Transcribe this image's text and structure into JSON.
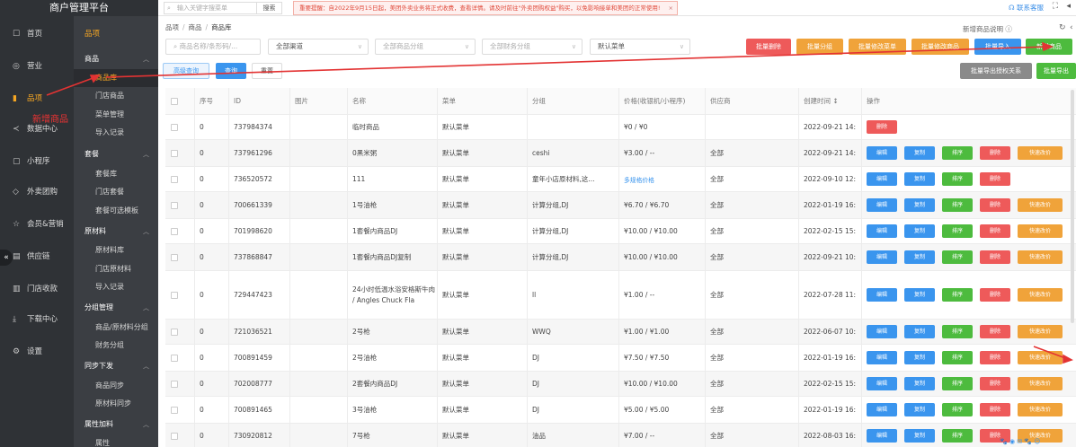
{
  "app": {
    "title": "商户管理平台"
  },
  "topbar": {
    "search_placeholder": "输入关键字搜菜单",
    "search_button": "搜索",
    "notice": "重要提醒：自2022年9月15日起，美团外卖业务将正式收费，查看详情。请及时前往\"外卖团购权益\"购买，以免影响接单和美团的正常使用!",
    "notice_close": "×",
    "service_label": "联系客服",
    "fullscreen_icon": "⛶"
  },
  "sidebar": {
    "items": [
      {
        "icon": "☐",
        "label": "首页",
        "active": false
      },
      {
        "icon": "◎",
        "label": "营业",
        "active": false
      },
      {
        "icon": "▮",
        "label": "品项",
        "active": true
      },
      {
        "icon": "≺",
        "label": "数据中心",
        "active": false
      },
      {
        "icon": "▢",
        "label": "小程序",
        "active": false
      },
      {
        "icon": "◇",
        "label": "外卖团购",
        "active": false
      },
      {
        "icon": "☆",
        "label": "会员&营销",
        "active": false
      },
      {
        "icon": "▤",
        "label": "供应链",
        "active": false
      },
      {
        "icon": "▥",
        "label": "门店收款",
        "active": false
      },
      {
        "icon": "⤓",
        "label": "下载中心",
        "active": false
      },
      {
        "icon": "⚙",
        "label": "设置",
        "active": false
      }
    ],
    "collapse_icon": "«"
  },
  "submenu": {
    "top": "品项",
    "groups": [
      {
        "label": "商品",
        "arrow": "︿",
        "items": [
          {
            "label": "商品库",
            "active": true
          },
          {
            "label": "门店商品",
            "active": false
          },
          {
            "label": "菜单管理",
            "active": false
          },
          {
            "label": "导入记录",
            "active": false
          }
        ]
      },
      {
        "label": "套餐",
        "arrow": "︿",
        "items": [
          {
            "label": "套餐库",
            "active": false
          },
          {
            "label": "门店套餐",
            "active": false
          },
          {
            "label": "套餐可选模板",
            "active": false
          }
        ]
      },
      {
        "label": "原材料",
        "arrow": "︿",
        "items": [
          {
            "label": "原材料库",
            "active": false
          },
          {
            "label": "门店原材料",
            "active": false
          },
          {
            "label": "导入记录",
            "active": false
          }
        ]
      },
      {
        "label": "分组管理",
        "arrow": "︿",
        "items": [
          {
            "label": "商品/原材料分组",
            "active": false
          },
          {
            "label": "财务分组",
            "active": false
          }
        ]
      },
      {
        "label": "同步下发",
        "arrow": "︿",
        "items": [
          {
            "label": "商品同步",
            "active": false
          },
          {
            "label": "原材料同步",
            "active": false
          }
        ]
      },
      {
        "label": "属性加料",
        "arrow": "︿",
        "items": [
          {
            "label": "属性",
            "active": false
          }
        ]
      }
    ]
  },
  "breadcrumb": {
    "items": [
      "品项",
      "商品",
      "商品库"
    ],
    "sep": "/"
  },
  "page": {
    "explain": "新增商品说明 ⓘ",
    "refresh_icon": "↻",
    "more_icon": "‹"
  },
  "filters": {
    "name_placeholder": "商品名称/条形码/...",
    "channel": "全部渠道",
    "category": "全部商品分组",
    "finance": "全部财务分组",
    "menu": "默认菜单",
    "advanced": "高级查询",
    "query": "查询",
    "reset": "重置"
  },
  "actions": {
    "batch_delete": "批量删除",
    "batch_group": "批量分组",
    "batch_menu": "批量修改菜单",
    "batch_edit": "批量修改商品",
    "batch_import": "批量导入",
    "add_product": "新增商品",
    "batch_export_auth": "批量导出授权关系",
    "batch_export": "批量导出"
  },
  "table": {
    "columns": [
      "",
      "序号",
      "ID",
      "图片",
      "名称",
      "菜单",
      "分组",
      "价格(收银机/小程序)",
      "供应商",
      "创建时间 ↕",
      "操作"
    ],
    "op_labels": {
      "edit": "编辑",
      "copy": "复制",
      "sort": "排序",
      "del": "删除",
      "quick": "快速改价"
    },
    "rows": [
      {
        "seq": "0",
        "id": "737984374",
        "name": "临时商品",
        "menu": "默认菜单",
        "group": "",
        "price": "¥0 / ¥0",
        "price_link": false,
        "supplier": "",
        "created": "2022-09-21 14:",
        "ops": [
          "del"
        ]
      },
      {
        "seq": "0",
        "id": "737961296",
        "name": "0黑米粥",
        "menu": "默认菜单",
        "group": "ceshi",
        "price": "¥3.00 / --",
        "price_link": false,
        "supplier": "全部",
        "created": "2022-09-21 14:",
        "ops": [
          "edit",
          "copy",
          "sort",
          "del",
          "quick"
        ]
      },
      {
        "seq": "0",
        "id": "736520572",
        "name": "111",
        "menu": "默认菜单",
        "group": "童年小店原材料,这...",
        "price": "多规格价格",
        "price_link": true,
        "supplier": "全部",
        "created": "2022-09-10 12:",
        "ops": [
          "edit",
          "copy",
          "sort",
          "del"
        ]
      },
      {
        "seq": "0",
        "id": "700661339",
        "name": "1号油枪",
        "menu": "默认菜单",
        "group": "计算分组,DJ",
        "price": "¥6.70 / ¥6.70",
        "price_link": false,
        "supplier": "全部",
        "created": "2022-01-19 16:",
        "ops": [
          "edit",
          "copy",
          "sort",
          "del",
          "quick"
        ]
      },
      {
        "seq": "0",
        "id": "701998620",
        "name": "1套餐内商品DJ",
        "menu": "默认菜单",
        "group": "计算分组,DJ",
        "price": "¥10.00 / ¥10.00",
        "price_link": false,
        "supplier": "全部",
        "created": "2022-02-15 15:",
        "ops": [
          "edit",
          "copy",
          "sort",
          "del",
          "quick"
        ]
      },
      {
        "seq": "0",
        "id": "737868847",
        "name": "1套餐内商品DJ复制",
        "menu": "默认菜单",
        "group": "计算分组,DJ",
        "price": "¥10.00 / ¥10.00",
        "price_link": false,
        "supplier": "全部",
        "created": "2022-09-21 10:",
        "ops": [
          "edit",
          "copy",
          "sort",
          "del",
          "quick"
        ]
      },
      {
        "seq": "0",
        "id": "729447423",
        "name": "24小时低温水浴安格斯牛肉 / Angles Chuck Fla",
        "menu": "默认菜单",
        "group": "ll",
        "price": "¥1.00 / --",
        "price_link": false,
        "supplier": "全部",
        "created": "2022-07-28 11:",
        "ops": [
          "edit",
          "copy",
          "sort",
          "del",
          "quick"
        ]
      },
      {
        "seq": "0",
        "id": "721036521",
        "name": "2号枪",
        "menu": "默认菜单",
        "group": "WWQ",
        "price": "¥1.00 / ¥1.00",
        "price_link": false,
        "supplier": "全部",
        "created": "2022-06-07 10:",
        "ops": [
          "edit",
          "copy",
          "sort",
          "del",
          "quick"
        ]
      },
      {
        "seq": "0",
        "id": "700891459",
        "name": "2号油枪",
        "menu": "默认菜单",
        "group": "DJ",
        "price": "¥7.50 / ¥7.50",
        "price_link": false,
        "supplier": "全部",
        "created": "2022-01-19 16:",
        "ops": [
          "edit",
          "copy",
          "sort",
          "del",
          "quick"
        ]
      },
      {
        "seq": "0",
        "id": "702008777",
        "name": "2套餐内商品DJ",
        "menu": "默认菜单",
        "group": "DJ",
        "price": "¥10.00 / ¥10.00",
        "price_link": false,
        "supplier": "全部",
        "created": "2022-02-15 15:",
        "ops": [
          "edit",
          "copy",
          "sort",
          "del",
          "quick"
        ]
      },
      {
        "seq": "0",
        "id": "700891465",
        "name": "3号油枪",
        "menu": "默认菜单",
        "group": "DJ",
        "price": "¥5.00 / ¥5.00",
        "price_link": false,
        "supplier": "全部",
        "created": "2022-01-19 16:",
        "ops": [
          "edit",
          "copy",
          "sort",
          "del",
          "quick"
        ]
      },
      {
        "seq": "0",
        "id": "730920812",
        "name": "7号枪",
        "menu": "默认菜单",
        "group": "油品",
        "price": "¥7.00 / --",
        "price_link": false,
        "supplier": "全部",
        "created": "2022-08-03 16:",
        "ops": [
          "edit",
          "copy",
          "sort",
          "del",
          "quick"
        ]
      }
    ]
  },
  "annotation": {
    "text": "新增商品",
    "color": "#e33333"
  },
  "bottom_status": "🐾 ◉ ✉ 🐾 ☺"
}
